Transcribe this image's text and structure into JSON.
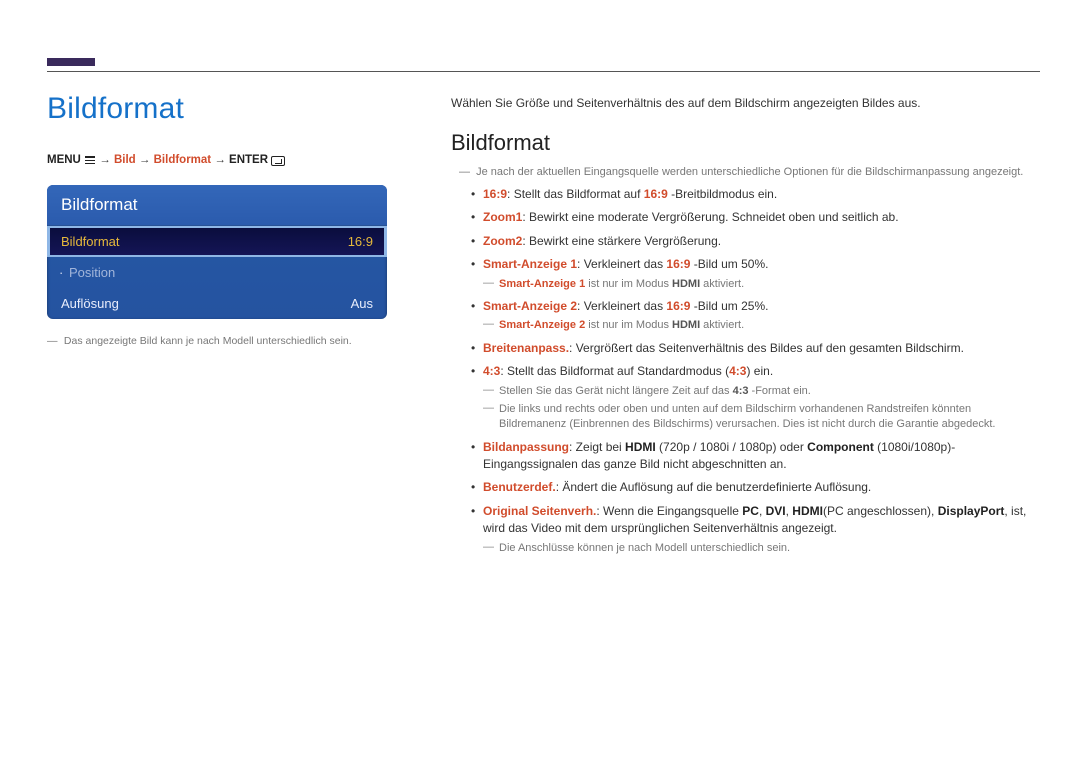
{
  "left": {
    "title": "Bildformat",
    "breadcrumb": {
      "menu": "MENU",
      "p1": "Bild",
      "p2": "Bildformat",
      "enter": "ENTER"
    },
    "osd": {
      "header": "Bildformat",
      "rows": [
        {
          "label": "Bildformat",
          "value": "16:9",
          "selected": true
        },
        {
          "label": "Position",
          "value": "",
          "kind": "pos"
        },
        {
          "label": "Auflösung",
          "value": "Aus",
          "kind": "white"
        }
      ]
    },
    "note_dash": "―",
    "note": "Das angezeigte Bild kann je nach Modell unterschiedlich sein."
  },
  "right": {
    "intro": "Wählen Sie Größe und Seitenverhältnis des auf dem Bildschirm angezeigten Bildes aus.",
    "heading": "Bildformat",
    "pre_note_dash": "―",
    "pre_note": "Je nach der aktuellen Eingangsquelle werden unterschiedliche Optionen für die Bildschirmanpassung angezeigt.",
    "items": {
      "i1": {
        "hl": "16:9",
        "rest": ": Stellt das Bildformat auf ",
        "hl2": "16:9",
        "rest2": " -Breitbildmodus ein."
      },
      "i2": {
        "hl": "Zoom1",
        "rest": ": Bewirkt eine moderate Vergrößerung. Schneidet oben und seitlich ab."
      },
      "i3": {
        "hl": "Zoom2",
        "rest": ": Bewirkt eine stärkere Vergrößerung."
      },
      "i4": {
        "hl": "Smart-Anzeige 1",
        "rest": ": Verkleinert das ",
        "hl2": "16:9",
        "rest2": " -Bild um 50%."
      },
      "i4n": {
        "hl": "Smart-Anzeige 1",
        "mid": " ist nur im Modus ",
        "b": "HDMI",
        "end": " aktiviert."
      },
      "i5": {
        "hl": "Smart-Anzeige 2",
        "rest": ": Verkleinert das ",
        "hl2": "16:9",
        "rest2": " -Bild um 25%."
      },
      "i5n": {
        "hl": "Smart-Anzeige 2",
        "mid": "  ist nur im Modus ",
        "b": "HDMI",
        "end": " aktiviert."
      },
      "i6": {
        "hl": "Breitenanpass.",
        "rest": ": Vergrößert das Seitenverhältnis des Bildes auf den gesamten Bildschirm."
      },
      "i7": {
        "hl": "4:3",
        "rest": ": Stellt das Bildformat auf Standardmodus (",
        "hl2": "4:3",
        "rest2": ") ein."
      },
      "i7n1": {
        "pre": "Stellen Sie das Gerät nicht längere Zeit auf das ",
        "b": "4:3",
        "post": " -Format ein."
      },
      "i7n2": "Die links und rechts oder oben und unten auf dem Bildschirm vorhandenen Randstreifen könnten Bildremanenz (Einbrennen des Bildschirms) verursachen. Dies ist nicht durch die Garantie abgedeckt.",
      "i8": {
        "hl": "Bildanpassung",
        "pre": ": Zeigt bei ",
        "b1": "HDMI",
        "mid1": " (720p / 1080i / 1080p) oder ",
        "b2": "Component",
        "mid2": " (1080i/1080p)-Eingangssignalen das ganze Bild nicht abgeschnitten an."
      },
      "i9": {
        "hl": "Benutzerdef.",
        "rest": ": Ändert die Auflösung auf die benutzerdefinierte Auflösung."
      },
      "i10": {
        "hl": "Original Seitenverh.",
        "pre": ": Wenn die Eingangsquelle ",
        "b1": "PC",
        "c1": ", ",
        "b2": "DVI",
        "c2": ", ",
        "b3": "HDMI",
        "mid": "(PC angeschlossen), ",
        "b4": "DisplayPort",
        "post": ", ist, wird das Video mit dem ursprünglichen Seitenverhältnis angezeigt."
      },
      "i10n": "Die Anschlüsse können je nach Modell unterschiedlich sein."
    }
  }
}
